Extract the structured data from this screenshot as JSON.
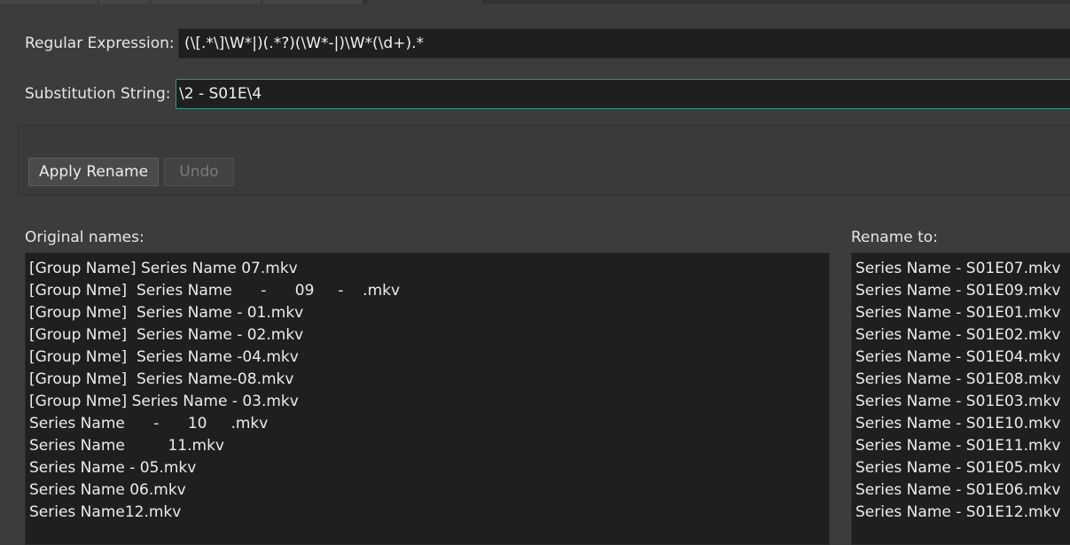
{
  "regex": {
    "label": "Regular Expression:",
    "value": "(\\[.*\\]\\W*|)(.*?)(\\W*-|)\\W*(\\d+).*"
  },
  "substitution": {
    "label": "Substitution String:",
    "value": "\\2 - S01E\\4"
  },
  "buttons": {
    "apply_label": "Apply Rename",
    "undo_label": "Undo"
  },
  "original": {
    "label": "Original names:",
    "items": [
      "[Group Name] Series Name 07.mkv",
      "[Group Nme]  Series Name      -      09     -    .mkv",
      "[Group Nme]  Series Name - 01.mkv",
      "[Group Nme]  Series Name - 02.mkv",
      "[Group Nme]  Series Name -04.mkv",
      "[Group Nme]  Series Name-08.mkv",
      "[Group Nme] Series Name - 03.mkv",
      "Series Name      -      10     .mkv",
      "Series Name         11.mkv",
      "Series Name - 05.mkv",
      "Series Name 06.mkv",
      "Series Name12.mkv"
    ]
  },
  "rename": {
    "label": "Rename to:",
    "items": [
      "Series Name - S01E07.mkv",
      "Series Name - S01E09.mkv",
      "Series Name - S01E01.mkv",
      "Series Name - S01E02.mkv",
      "Series Name - S01E04.mkv",
      "Series Name - S01E08.mkv",
      "Series Name - S01E03.mkv",
      "Series Name - S01E10.mkv",
      "Series Name - S01E11.mkv",
      "Series Name - S01E05.mkv",
      "Series Name - S01E06.mkv",
      "Series Name - S01E12.mkv"
    ]
  },
  "colors": {
    "background": "#3c3c3c",
    "field_background": "#1f1f1f",
    "focus_border": "#3f8f86"
  }
}
